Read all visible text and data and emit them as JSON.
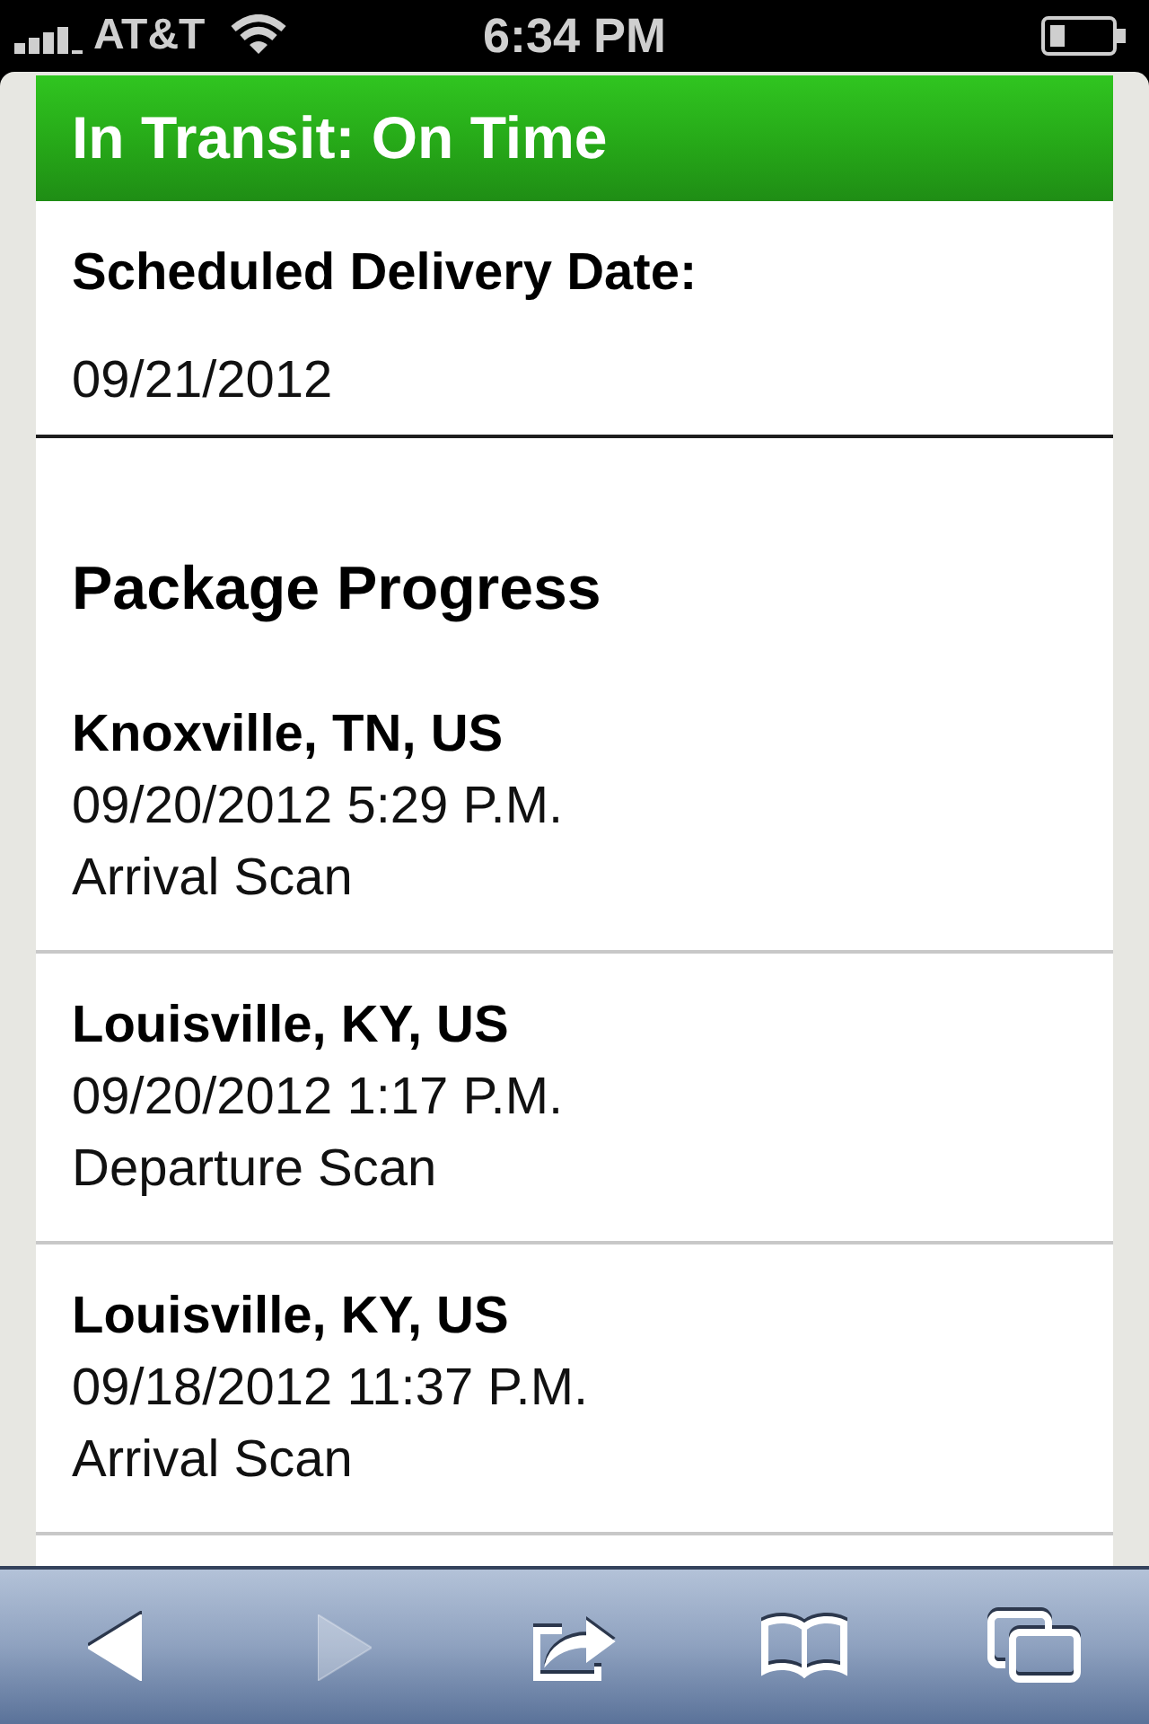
{
  "status_bar": {
    "carrier": "AT&T",
    "time": "6:34 PM"
  },
  "status_header": {
    "title": "In Transit: On Time"
  },
  "scheduled_delivery": {
    "label": "Scheduled Delivery Date:",
    "date": "09/21/2012"
  },
  "package_progress": {
    "heading": "Package Progress",
    "events": [
      {
        "location": "Knoxville, TN, US",
        "datetime": "09/20/2012 5:29 P.M.",
        "activity": "Arrival Scan"
      },
      {
        "location": "Louisville, KY, US",
        "datetime": "09/20/2012 1:17 P.M.",
        "activity": "Departure Scan"
      },
      {
        "location": "Louisville, KY, US",
        "datetime": "09/18/2012 11:37 P.M.",
        "activity": "Arrival Scan"
      }
    ]
  },
  "toolbar": {
    "buttons": [
      {
        "kind": "back",
        "disabled": false
      },
      {
        "kind": "forward",
        "disabled": true
      },
      {
        "kind": "share",
        "disabled": false
      },
      {
        "kind": "bookmarks",
        "disabled": false
      },
      {
        "kind": "tabs",
        "disabled": false
      }
    ]
  }
}
